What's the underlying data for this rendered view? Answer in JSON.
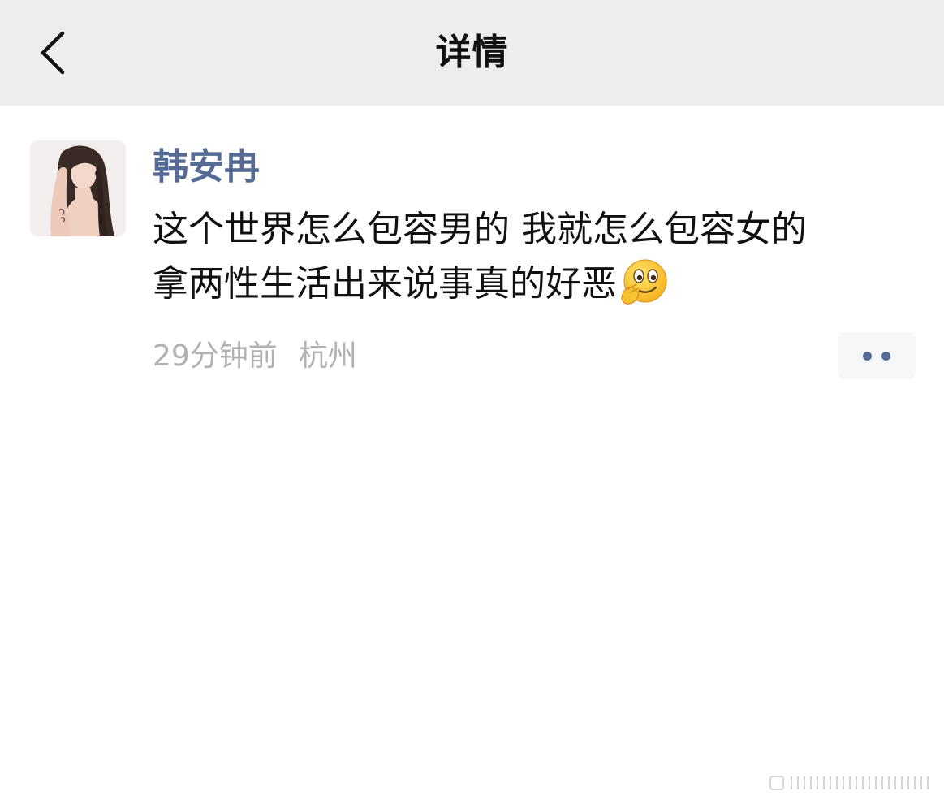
{
  "nav": {
    "title": "详情",
    "back_icon": "chevron-left-icon"
  },
  "post": {
    "author": "韩安冉",
    "text_lines": [
      "这个世界怎么包容男的 我就怎么包容女的",
      "拿两性生活出来说事真的好恶"
    ],
    "emoji": "smirk-hand-emoji",
    "time": "29分钟前",
    "location": "杭州",
    "more_icon": "more-dots-icon"
  },
  "colors": {
    "nav_bg": "#ededed",
    "author_link": "#566b94",
    "meta_gray": "#b2b2b2"
  }
}
